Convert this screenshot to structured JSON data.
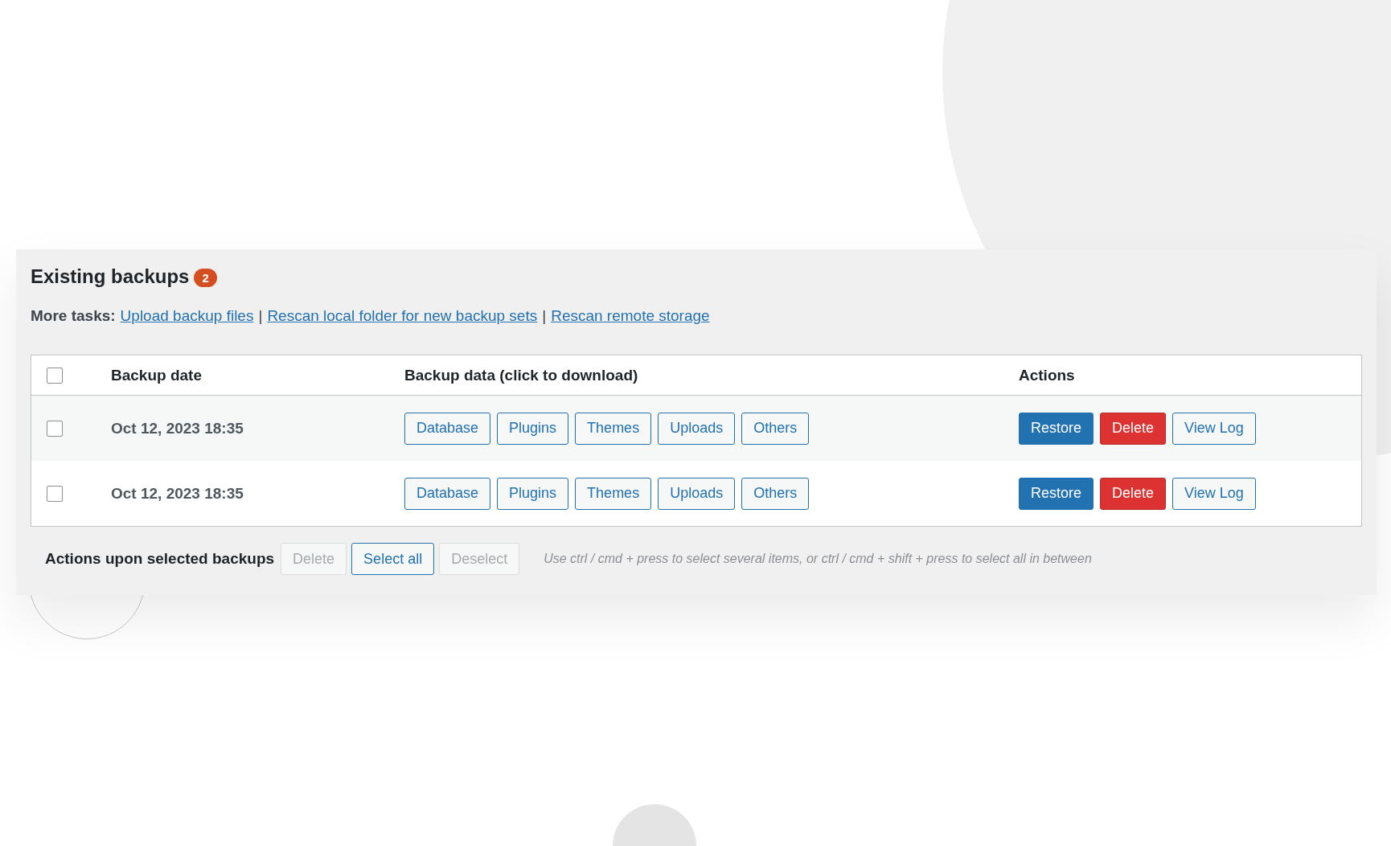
{
  "panel": {
    "title": "Existing backups",
    "count": "2",
    "more_tasks_label": "More tasks:",
    "links": [
      "Upload backup files",
      "Rescan local folder for new backup sets",
      "Rescan remote storage"
    ],
    "separator": "|"
  },
  "table": {
    "select_all_checked": false,
    "columns": [
      "Backup date",
      "Backup data (click to download)",
      "Actions"
    ],
    "rows": [
      {
        "checked": false,
        "date": "Oct 12, 2023 18:35",
        "data": [
          "Database",
          "Plugins",
          "Themes",
          "Uploads",
          "Others"
        ],
        "actions": [
          {
            "label": "Restore",
            "kind": "primary"
          },
          {
            "label": "Delete",
            "kind": "danger"
          },
          {
            "label": "View Log",
            "kind": "secondary"
          }
        ]
      },
      {
        "checked": false,
        "date": "Oct 12, 2023 18:35",
        "data": [
          "Database",
          "Plugins",
          "Themes",
          "Uploads",
          "Others"
        ],
        "actions": [
          {
            "label": "Restore",
            "kind": "primary"
          },
          {
            "label": "Delete",
            "kind": "danger"
          },
          {
            "label": "View Log",
            "kind": "secondary"
          }
        ]
      }
    ]
  },
  "footer": {
    "label": "Actions upon selected backups",
    "buttons": [
      {
        "label": "Delete",
        "disabled": true
      },
      {
        "label": "Select all",
        "disabled": false
      },
      {
        "label": "Deselect",
        "disabled": true
      }
    ],
    "hint": "Use ctrl / cmd + press to select several items, or ctrl / cmd + shift + press to select all in between"
  }
}
